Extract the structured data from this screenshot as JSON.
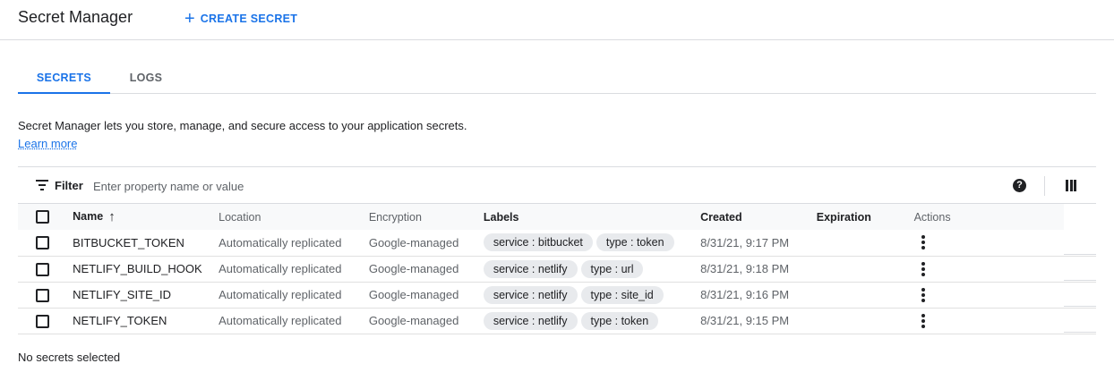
{
  "header": {
    "title": "Secret Manager",
    "create_icon": "plus-icon",
    "create_label": "CREATE SECRET"
  },
  "tabs": [
    {
      "label": "SECRETS",
      "active": true
    },
    {
      "label": "LOGS",
      "active": false
    }
  ],
  "description": {
    "text": "Secret Manager lets you store, manage, and secure access to your application secrets.",
    "link": "Learn more"
  },
  "filter": {
    "icon": "filter-lines-icon",
    "label": "Filter",
    "placeholder": "Enter property name or value",
    "help_icon": "help-circle-icon",
    "columns_icon": "column-display-icon"
  },
  "table": {
    "columns": {
      "name": "Name",
      "location": "Location",
      "encryption": "Encryption",
      "labels": "Labels",
      "created": "Created",
      "expiration": "Expiration",
      "actions": "Actions"
    },
    "sort_icon": "arrow-up-icon",
    "rows": [
      {
        "name": "BITBUCKET_TOKEN",
        "location": "Automatically replicated",
        "encryption": "Google-managed",
        "labels": [
          "service : bitbucket",
          "type : token"
        ],
        "created": "8/31/21, 9:17 PM",
        "expiration": ""
      },
      {
        "name": "NETLIFY_BUILD_HOOK",
        "location": "Automatically replicated",
        "encryption": "Google-managed",
        "labels": [
          "service : netlify",
          "type : url"
        ],
        "created": "8/31/21, 9:18 PM",
        "expiration": ""
      },
      {
        "name": "NETLIFY_SITE_ID",
        "location": "Automatically replicated",
        "encryption": "Google-managed",
        "labels": [
          "service : netlify",
          "type : site_id"
        ],
        "created": "8/31/21, 9:16 PM",
        "expiration": ""
      },
      {
        "name": "NETLIFY_TOKEN",
        "location": "Automatically replicated",
        "encryption": "Google-managed",
        "labels": [
          "service : netlify",
          "type : token"
        ],
        "created": "8/31/21, 9:15 PM",
        "expiration": ""
      }
    ]
  },
  "status": "No secrets selected",
  "colors": {
    "accent": "#1a73e8",
    "chip_bg": "#e8eaed",
    "header_bg": "#f8f9fa"
  }
}
